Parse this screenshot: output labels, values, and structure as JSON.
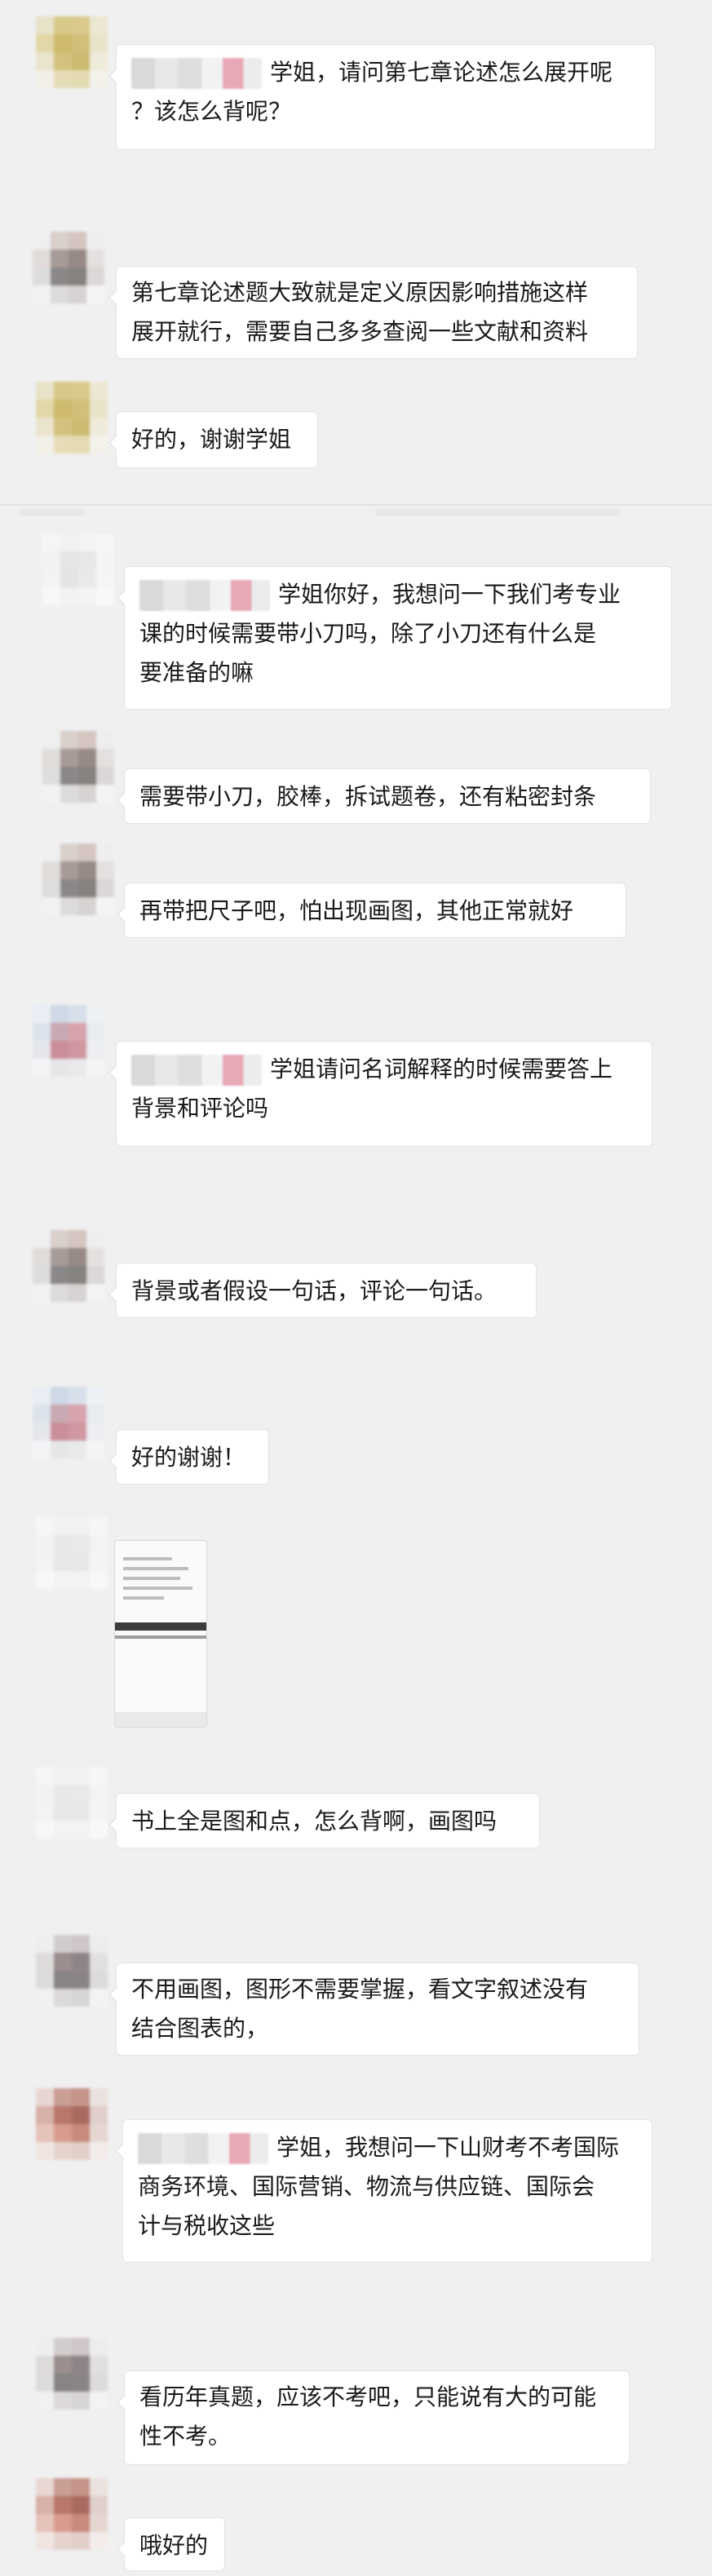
{
  "conversation": {
    "messages": [
      {
        "id": "m1",
        "redacted_prefix": true,
        "line1": "学姐，请问第七章论述怎么展开呢",
        "line2": "？该怎么背呢？"
      },
      {
        "id": "m2",
        "line1": "第七章论述题大致就是定义原因影响措施这样",
        "line2": "展开就行，需要自己多多查阅一些文献和资料"
      },
      {
        "id": "m3",
        "line1": "好的，谢谢学姐"
      },
      {
        "id": "m4",
        "redacted_prefix": true,
        "line1": "学姐你好，我想问一下我们考专业",
        "line2": "课的时候需要带小刀吗，除了小刀还有什么是",
        "line3": "要准备的嘛"
      },
      {
        "id": "m5",
        "line1": "需要带小刀，胶棒，拆试题卷，还有粘密封条"
      },
      {
        "id": "m6",
        "line1": "再带把尺子吧，怕出现画图，其他正常就好"
      },
      {
        "id": "m7",
        "redacted_prefix": true,
        "line1": "学姐请问名词解释的时候需要答上",
        "line2": "背景和评论吗"
      },
      {
        "id": "m8",
        "line1": "背景或者假设一句话，评论一句话。"
      },
      {
        "id": "m9",
        "line1": "好的谢谢！"
      },
      {
        "id": "m10",
        "line1": "书上全是图和点，怎么背啊，画图吗"
      },
      {
        "id": "m11",
        "line1": "不用画图，图形不需要掌握，看文字叙述没有",
        "line2": "结合图表的，"
      },
      {
        "id": "m12",
        "redacted_prefix": true,
        "line1": "学姐，我想问一下山财考不考国际",
        "line2": "商务环境、国际营销、物流与供应链、国际会",
        "line3": "计与税收这些"
      },
      {
        "id": "m13",
        "line1": "看历年真题，应该不考吧，只能说有大的可能",
        "line2": "性不考。"
      },
      {
        "id": "m14",
        "line1": "哦好的"
      }
    ]
  },
  "colors": {
    "background": "#f0f0f0",
    "bubble": "#ffffff",
    "bubble_border": "#e3e3e3",
    "redaction_accent": "#e8a9b6"
  }
}
